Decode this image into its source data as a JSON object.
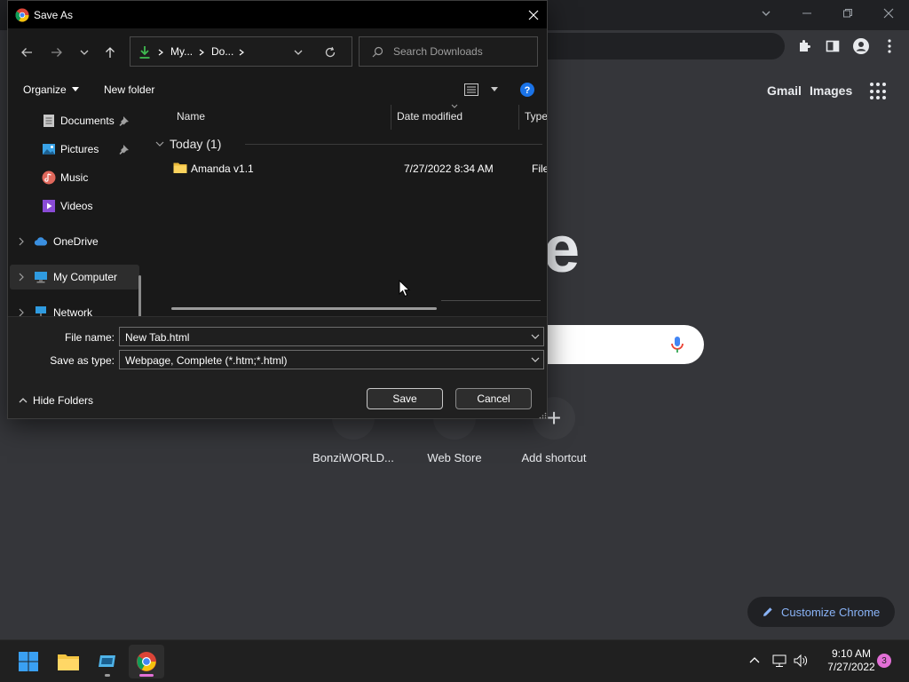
{
  "dialog": {
    "title": "Save As",
    "breadcrumbs": [
      "My...",
      "Do..."
    ],
    "search_placeholder": "Search Downloads",
    "commands": {
      "organize": "Organize",
      "new_folder": "New folder"
    },
    "nav_items": [
      {
        "label": "Documents",
        "pinned": true
      },
      {
        "label": "Pictures",
        "pinned": true
      },
      {
        "label": "Music"
      },
      {
        "label": "Videos"
      },
      {
        "label": "OneDrive",
        "expandable": true
      },
      {
        "label": "My Computer",
        "expandable": true,
        "selected": true
      },
      {
        "label": "Network",
        "expandable": true
      }
    ],
    "columns": {
      "name": "Name",
      "date": "Date modified",
      "type": "Type"
    },
    "group": {
      "label": "Today (1)"
    },
    "files": [
      {
        "name": "Amanda v1.1",
        "date": "7/27/2022 8:34 AM",
        "type": "File fo"
      }
    ],
    "file_name_label": "File name:",
    "file_name_value": "New Tab.html",
    "save_type_label": "Save as type:",
    "save_type_value": "Webpage, Complete (*.htm;*.html)",
    "hide_folders": "Hide Folders",
    "save_label": "Save",
    "cancel_label": "Cancel"
  },
  "chrome": {
    "links": {
      "gmail": "Gmail",
      "images": "Images"
    },
    "logo_fragment": "e",
    "shortcuts": [
      {
        "label": "BonziWORLD..."
      },
      {
        "label": "Web Store"
      },
      {
        "label": "Add shortcut",
        "glyph": "+"
      }
    ],
    "customize_label": "Customize Chrome"
  },
  "taskbar": {
    "time": "9:10 AM",
    "date": "7/27/2022",
    "notification_count": "3"
  },
  "colors": {
    "accent_blue": "#8ab4f8",
    "downloads_green": "#3fb950",
    "help_blue": "#1a73e8",
    "badge_pink": "#e26fd6"
  }
}
